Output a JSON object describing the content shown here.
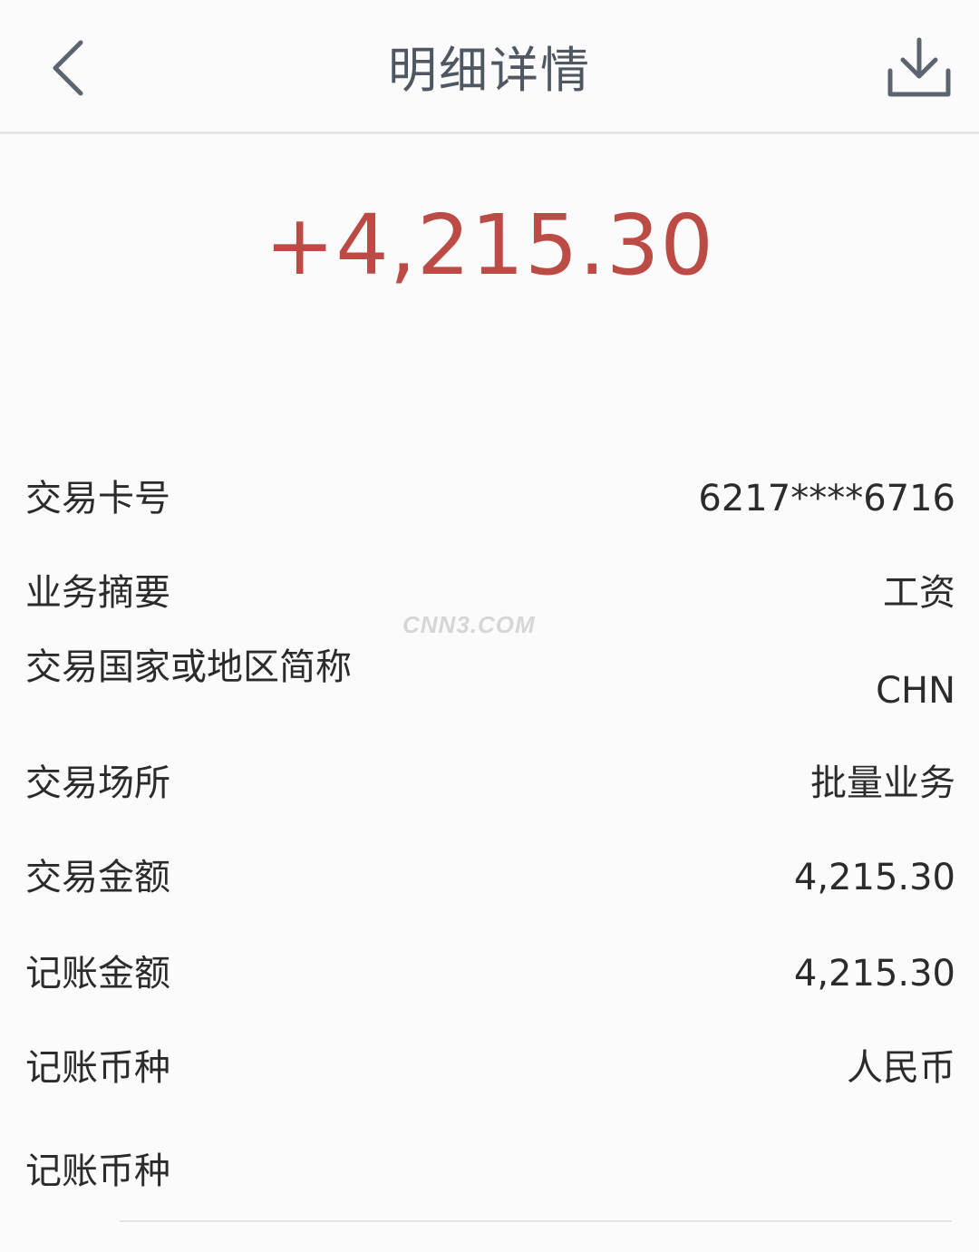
{
  "header": {
    "title": "明细详情"
  },
  "amount": "+4,215.30",
  "details": [
    {
      "label": "交易卡号",
      "value": "6217****6716"
    },
    {
      "label": "业务摘要",
      "value": "工资"
    },
    {
      "label": "交易国家或地区简称",
      "value": "CHN"
    },
    {
      "label": "交易场所",
      "value": "批量业务"
    },
    {
      "label": "交易金额",
      "value": "4,215.30"
    },
    {
      "label": "记账金额",
      "value": "4,215.30"
    },
    {
      "label": "记账币种",
      "value": "人民币"
    },
    {
      "label": "记账币种",
      "value": ""
    }
  ],
  "watermark": "CNN3.COM",
  "colors": {
    "amount": "#bc4a45",
    "title": "#4f5763",
    "icon": "#5b6470"
  },
  "icons": {
    "back": "chevron-left-icon",
    "download": "download-icon"
  }
}
